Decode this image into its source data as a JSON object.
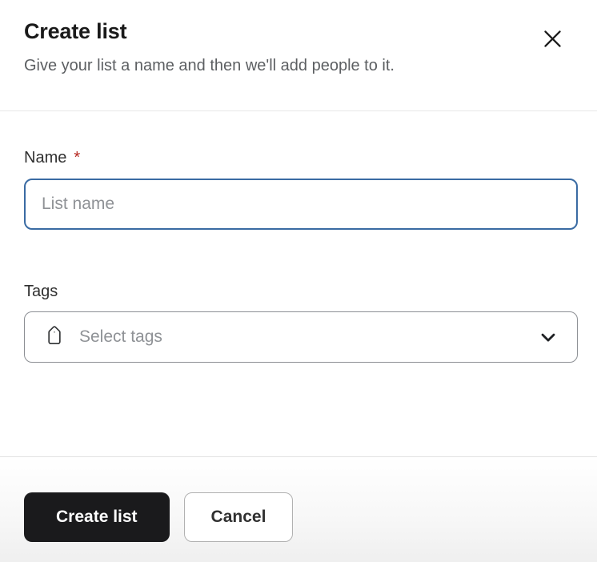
{
  "modal": {
    "title": "Create list",
    "subtitle": "Give your list a name and then we'll add people to it."
  },
  "form": {
    "name_field": {
      "label": "Name",
      "required_marker": "*",
      "placeholder": "List name",
      "value": ""
    },
    "tags_field": {
      "label": "Tags",
      "placeholder": "Select tags",
      "icon": "tag-icon",
      "chevron": "chevron-down-icon"
    }
  },
  "footer": {
    "primary_label": "Create list",
    "secondary_label": "Cancel"
  },
  "colors": {
    "accent_focus": "#3a6ba3",
    "required": "#b5271f",
    "primary_button_bg": "#1a1a1c",
    "text_primary": "#1a1a1a",
    "text_secondary": "#5c5f62",
    "placeholder": "#8f9296",
    "border_gray": "#8c8f94",
    "divider": "#e7e7e7"
  }
}
